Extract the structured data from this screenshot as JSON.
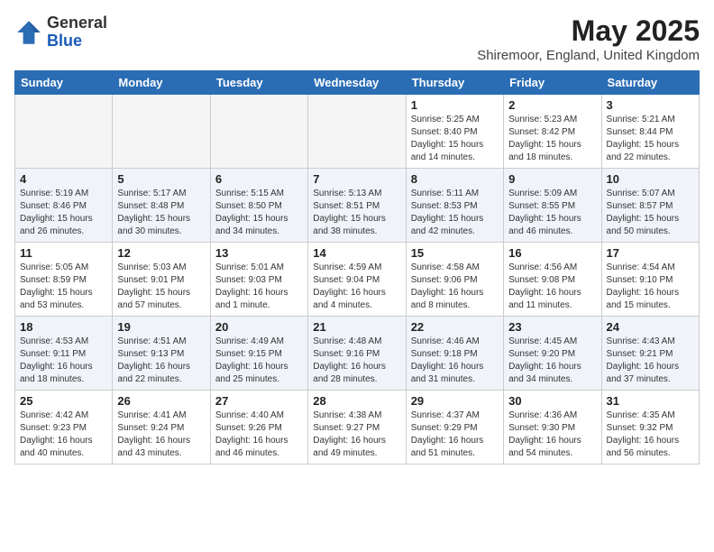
{
  "header": {
    "logo_line1": "General",
    "logo_line2": "Blue",
    "month_year": "May 2025",
    "location": "Shiremoor, England, United Kingdom"
  },
  "weekdays": [
    "Sunday",
    "Monday",
    "Tuesday",
    "Wednesday",
    "Thursday",
    "Friday",
    "Saturday"
  ],
  "weeks": [
    [
      {
        "day": "",
        "info": ""
      },
      {
        "day": "",
        "info": ""
      },
      {
        "day": "",
        "info": ""
      },
      {
        "day": "",
        "info": ""
      },
      {
        "day": "1",
        "info": "Sunrise: 5:25 AM\nSunset: 8:40 PM\nDaylight: 15 hours\nand 14 minutes."
      },
      {
        "day": "2",
        "info": "Sunrise: 5:23 AM\nSunset: 8:42 PM\nDaylight: 15 hours\nand 18 minutes."
      },
      {
        "day": "3",
        "info": "Sunrise: 5:21 AM\nSunset: 8:44 PM\nDaylight: 15 hours\nand 22 minutes."
      }
    ],
    [
      {
        "day": "4",
        "info": "Sunrise: 5:19 AM\nSunset: 8:46 PM\nDaylight: 15 hours\nand 26 minutes."
      },
      {
        "day": "5",
        "info": "Sunrise: 5:17 AM\nSunset: 8:48 PM\nDaylight: 15 hours\nand 30 minutes."
      },
      {
        "day": "6",
        "info": "Sunrise: 5:15 AM\nSunset: 8:50 PM\nDaylight: 15 hours\nand 34 minutes."
      },
      {
        "day": "7",
        "info": "Sunrise: 5:13 AM\nSunset: 8:51 PM\nDaylight: 15 hours\nand 38 minutes."
      },
      {
        "day": "8",
        "info": "Sunrise: 5:11 AM\nSunset: 8:53 PM\nDaylight: 15 hours\nand 42 minutes."
      },
      {
        "day": "9",
        "info": "Sunrise: 5:09 AM\nSunset: 8:55 PM\nDaylight: 15 hours\nand 46 minutes."
      },
      {
        "day": "10",
        "info": "Sunrise: 5:07 AM\nSunset: 8:57 PM\nDaylight: 15 hours\nand 50 minutes."
      }
    ],
    [
      {
        "day": "11",
        "info": "Sunrise: 5:05 AM\nSunset: 8:59 PM\nDaylight: 15 hours\nand 53 minutes."
      },
      {
        "day": "12",
        "info": "Sunrise: 5:03 AM\nSunset: 9:01 PM\nDaylight: 15 hours\nand 57 minutes."
      },
      {
        "day": "13",
        "info": "Sunrise: 5:01 AM\nSunset: 9:03 PM\nDaylight: 16 hours\nand 1 minute."
      },
      {
        "day": "14",
        "info": "Sunrise: 4:59 AM\nSunset: 9:04 PM\nDaylight: 16 hours\nand 4 minutes."
      },
      {
        "day": "15",
        "info": "Sunrise: 4:58 AM\nSunset: 9:06 PM\nDaylight: 16 hours\nand 8 minutes."
      },
      {
        "day": "16",
        "info": "Sunrise: 4:56 AM\nSunset: 9:08 PM\nDaylight: 16 hours\nand 11 minutes."
      },
      {
        "day": "17",
        "info": "Sunrise: 4:54 AM\nSunset: 9:10 PM\nDaylight: 16 hours\nand 15 minutes."
      }
    ],
    [
      {
        "day": "18",
        "info": "Sunrise: 4:53 AM\nSunset: 9:11 PM\nDaylight: 16 hours\nand 18 minutes."
      },
      {
        "day": "19",
        "info": "Sunrise: 4:51 AM\nSunset: 9:13 PM\nDaylight: 16 hours\nand 22 minutes."
      },
      {
        "day": "20",
        "info": "Sunrise: 4:49 AM\nSunset: 9:15 PM\nDaylight: 16 hours\nand 25 minutes."
      },
      {
        "day": "21",
        "info": "Sunrise: 4:48 AM\nSunset: 9:16 PM\nDaylight: 16 hours\nand 28 minutes."
      },
      {
        "day": "22",
        "info": "Sunrise: 4:46 AM\nSunset: 9:18 PM\nDaylight: 16 hours\nand 31 minutes."
      },
      {
        "day": "23",
        "info": "Sunrise: 4:45 AM\nSunset: 9:20 PM\nDaylight: 16 hours\nand 34 minutes."
      },
      {
        "day": "24",
        "info": "Sunrise: 4:43 AM\nSunset: 9:21 PM\nDaylight: 16 hours\nand 37 minutes."
      }
    ],
    [
      {
        "day": "25",
        "info": "Sunrise: 4:42 AM\nSunset: 9:23 PM\nDaylight: 16 hours\nand 40 minutes."
      },
      {
        "day": "26",
        "info": "Sunrise: 4:41 AM\nSunset: 9:24 PM\nDaylight: 16 hours\nand 43 minutes."
      },
      {
        "day": "27",
        "info": "Sunrise: 4:40 AM\nSunset: 9:26 PM\nDaylight: 16 hours\nand 46 minutes."
      },
      {
        "day": "28",
        "info": "Sunrise: 4:38 AM\nSunset: 9:27 PM\nDaylight: 16 hours\nand 49 minutes."
      },
      {
        "day": "29",
        "info": "Sunrise: 4:37 AM\nSunset: 9:29 PM\nDaylight: 16 hours\nand 51 minutes."
      },
      {
        "day": "30",
        "info": "Sunrise: 4:36 AM\nSunset: 9:30 PM\nDaylight: 16 hours\nand 54 minutes."
      },
      {
        "day": "31",
        "info": "Sunrise: 4:35 AM\nSunset: 9:32 PM\nDaylight: 16 hours\nand 56 minutes."
      }
    ]
  ]
}
